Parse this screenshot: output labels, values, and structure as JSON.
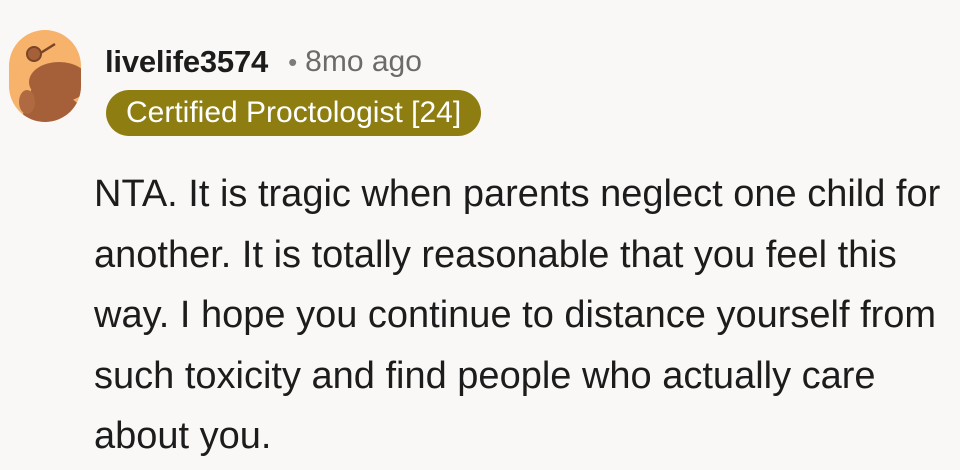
{
  "comment": {
    "username": "livelife3574",
    "separator": "•",
    "age": "8mo ago",
    "flair": "Certified Proctologist [24]",
    "body": "NTA. It is tragic when parents neglect one child for another. It is totally reasonable that you feel this way. I hope you continue to distance yourself from such toxicity and find people who actually care about you."
  },
  "avatar": {
    "icon": "snoo-avatar-icon",
    "background_color": "#f7b26c",
    "figure_color": "#a5603a"
  },
  "colors": {
    "page_background": "#faf8f7",
    "flair_background": "#8e7e12",
    "flair_text": "#ffffff",
    "text": "#1c1c1c",
    "meta_text": "#6b6b6b"
  }
}
